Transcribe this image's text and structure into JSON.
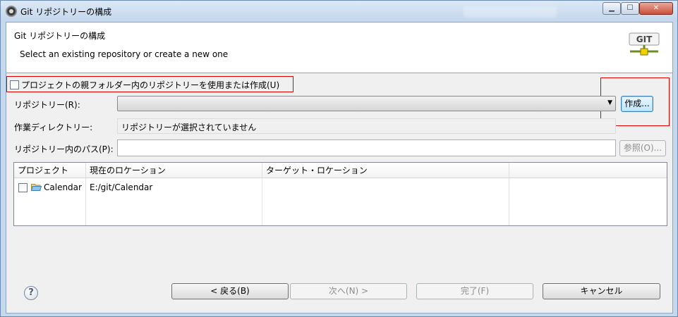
{
  "window": {
    "title": "Git リポジトリーの構成",
    "controls": {
      "minimize": "▁",
      "maximize": "☐",
      "close": "✕"
    }
  },
  "header": {
    "title": "Git リポジトリーの構成",
    "description": "Select an existing repository or create a new one",
    "logo_text": "GIT"
  },
  "options": {
    "use_parent_repo_label": "プロジェクトの親フォルダー内のリポジトリーを使用または作成(U)",
    "use_parent_repo_checked": false
  },
  "form": {
    "repository_label": "リポジトリー(R):",
    "repository_value": "",
    "create_button": "作成...",
    "working_dir_label": "作業ディレクトリー:",
    "working_dir_value": "リポジトリーが選択されていません",
    "path_label": "リポジトリー内のパス(P):",
    "path_value": "",
    "browse_button": "参照(O)..."
  },
  "table": {
    "columns": [
      "プロジェクト",
      "現在のロケーション",
      "ターゲット・ロケーション",
      ""
    ],
    "rows": [
      {
        "checked": false,
        "project": "Calendar",
        "current_location": "E:/git/Calendar",
        "target_location": ""
      }
    ]
  },
  "footer": {
    "help_icon": "?",
    "back_button": "< 戻る(B)",
    "next_button": "次へ(N) >",
    "finish_button": "完了(F)",
    "cancel_button": "キャンセル"
  },
  "colors": {
    "highlight_red": "#e00000",
    "window_frame": "#c6d8ec",
    "dialog_bg": "#f0f0f0"
  }
}
